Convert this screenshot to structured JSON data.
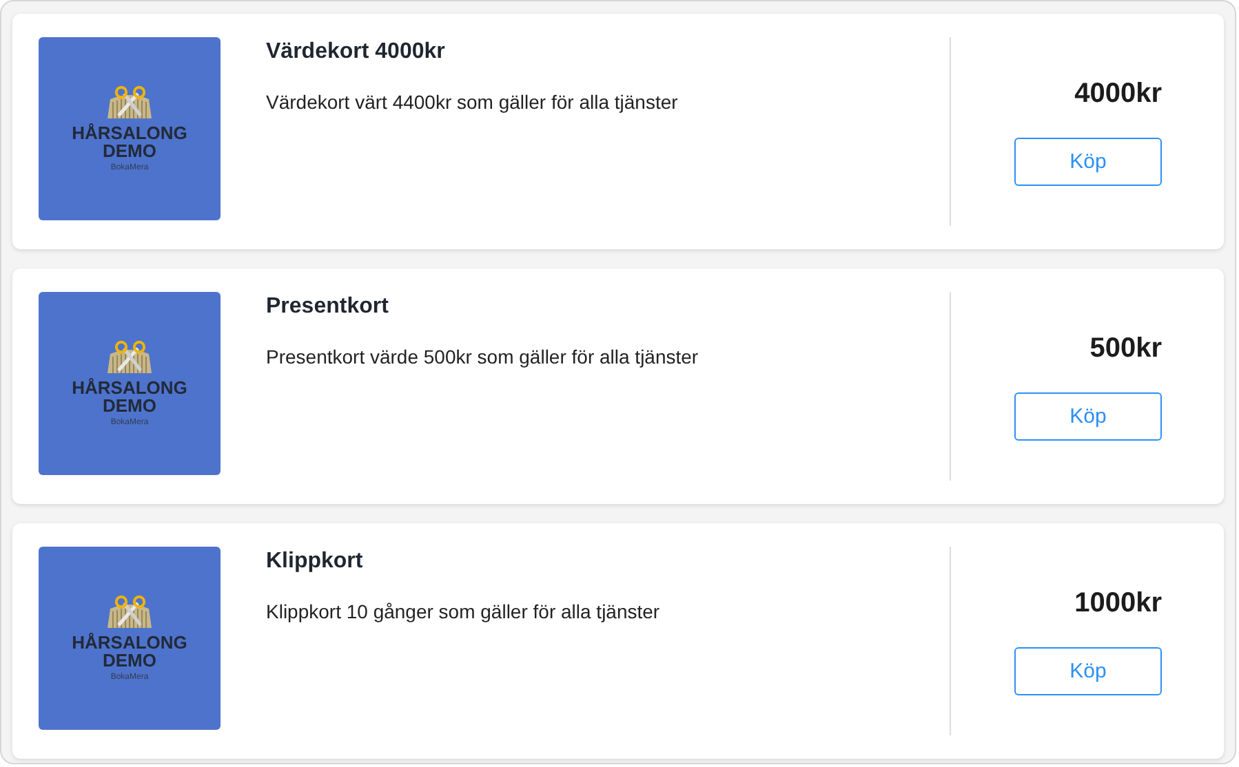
{
  "cards": [
    {
      "logo": {
        "name": "HÅRSALONG DEMO",
        "sub": "BokaMera"
      },
      "title": "Värdekort 4000kr",
      "description": "Värdekort värt 4400kr som gäller för alla tjänster",
      "price": "4000kr",
      "button": "Köp"
    },
    {
      "logo": {
        "name": "HÅRSALONG DEMO",
        "sub": "BokaMera"
      },
      "title": "Presentkort",
      "description": "Presentkort värde 500kr som gäller för alla tjänster",
      "price": "500kr",
      "button": "Köp"
    },
    {
      "logo": {
        "name": "HÅRSALONG DEMO",
        "sub": "BokaMera"
      },
      "title": "Klippkort",
      "description": "Klippkort 10 gånger som gäller för alla tjänster",
      "price": "1000kr",
      "button": "Köp"
    }
  ]
}
